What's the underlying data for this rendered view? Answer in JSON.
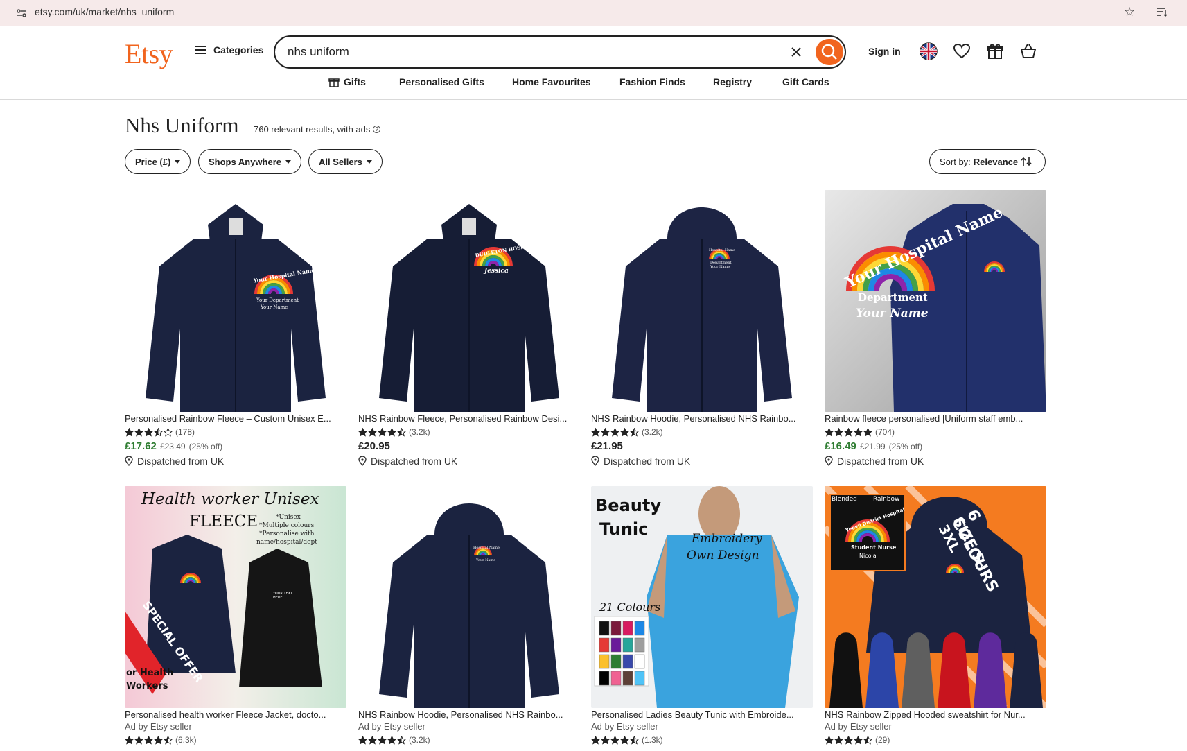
{
  "browser": {
    "url": "etsy.com/uk/market/nhs_uniform"
  },
  "header": {
    "logo": "Etsy",
    "categories_label": "Categories",
    "search_value": "nhs uniform",
    "signin_label": "Sign in",
    "nav": [
      {
        "label": "Gifts",
        "icon": "gift-icon"
      },
      {
        "label": "Personalised Gifts"
      },
      {
        "label": "Home Favourites"
      },
      {
        "label": "Fashion Finds"
      },
      {
        "label": "Registry"
      },
      {
        "label": "Gift Cards"
      }
    ]
  },
  "results": {
    "title": "Nhs Uniform",
    "count_text": "760 relevant results, with ads",
    "filters": [
      "Price (£)",
      "Shops Anywhere",
      "All Sellers"
    ],
    "sort_prefix": "Sort by:",
    "sort_value": "Relevance"
  },
  "products": [
    {
      "name": "Personalised Rainbow Fleece – Custom Unisex E...",
      "rating": 3.5,
      "reviews": "(178)",
      "price": "£17.62",
      "original_price": "£23.49",
      "discount": "(25% off)",
      "dispatch": "Dispatched from UK",
      "image_text": [
        "Your Hospital Name",
        "Your Department",
        "Your Name"
      ]
    },
    {
      "name": "NHS Rainbow Fleece, Personalised Rainbow Desi...",
      "rating": 4.5,
      "reviews": "(3.2k)",
      "price": "£20.95",
      "dispatch": "Dispatched from UK",
      "image_text": [
        "DUDLETON HOSPITAL",
        "Jessica"
      ]
    },
    {
      "name": "NHS Rainbow Hoodie, Personalised NHS Rainbo...",
      "rating": 4.5,
      "reviews": "(3.2k)",
      "price": "£21.95",
      "dispatch": "Dispatched from UK",
      "image_text": [
        "Hospital Name",
        "Department",
        "Your Name"
      ]
    },
    {
      "name": "Rainbow fleece personalised |Uniform staff emb...",
      "rating": 5,
      "reviews": "(704)",
      "price": "£16.49",
      "original_price": "£21.99",
      "discount": "(25% off)",
      "dispatch": "Dispatched from UK",
      "image_text": [
        "Your Hospital Name",
        "Department",
        "Your Name"
      ]
    },
    {
      "name": "Personalised health worker Fleece Jacket, docto...",
      "ad": "Ad by Etsy seller",
      "rating": 4.5,
      "reviews": "(6.3k)",
      "image_text": [
        "Health worker Unisex",
        "FLEECE",
        "*Unisex",
        "*Multiple colours",
        "*Personalise with",
        "name/hospital/dept",
        "SPECIAL OFFER",
        "or Health",
        "Workers",
        "YOUR TEXT HERE"
      ]
    },
    {
      "name": "NHS Rainbow Hoodie, Personalised NHS Rainbo...",
      "ad": "Ad by Etsy seller",
      "rating": 4.5,
      "reviews": "(3.2k)",
      "image_text": [
        "Hospital Name",
        "Your Name"
      ]
    },
    {
      "name": "Personalised Ladies Beauty Tunic with Embroide...",
      "ad": "Ad by Etsy seller",
      "rating": 4.5,
      "reviews": "(1.3k)",
      "image_text": [
        "Beauty",
        "Tunic",
        "Embroidery",
        "Own Design",
        "21 Colours"
      ]
    },
    {
      "name": "NHS Rainbow Zipped Hooded sweatshirt for Nur...",
      "ad": "Ad by Etsy seller",
      "rating": 4.5,
      "reviews": "(29)",
      "image_text": [
        "Blended",
        "Rainbow",
        "Yeovil District Hospital",
        "Student Nurse",
        "Nicola",
        "6 COLOURS",
        "SIZE S-3XL"
      ]
    }
  ],
  "colors": {
    "brand": "#f1641e",
    "sale_price": "#2f7d32",
    "navy_garment": "#1b2340"
  }
}
